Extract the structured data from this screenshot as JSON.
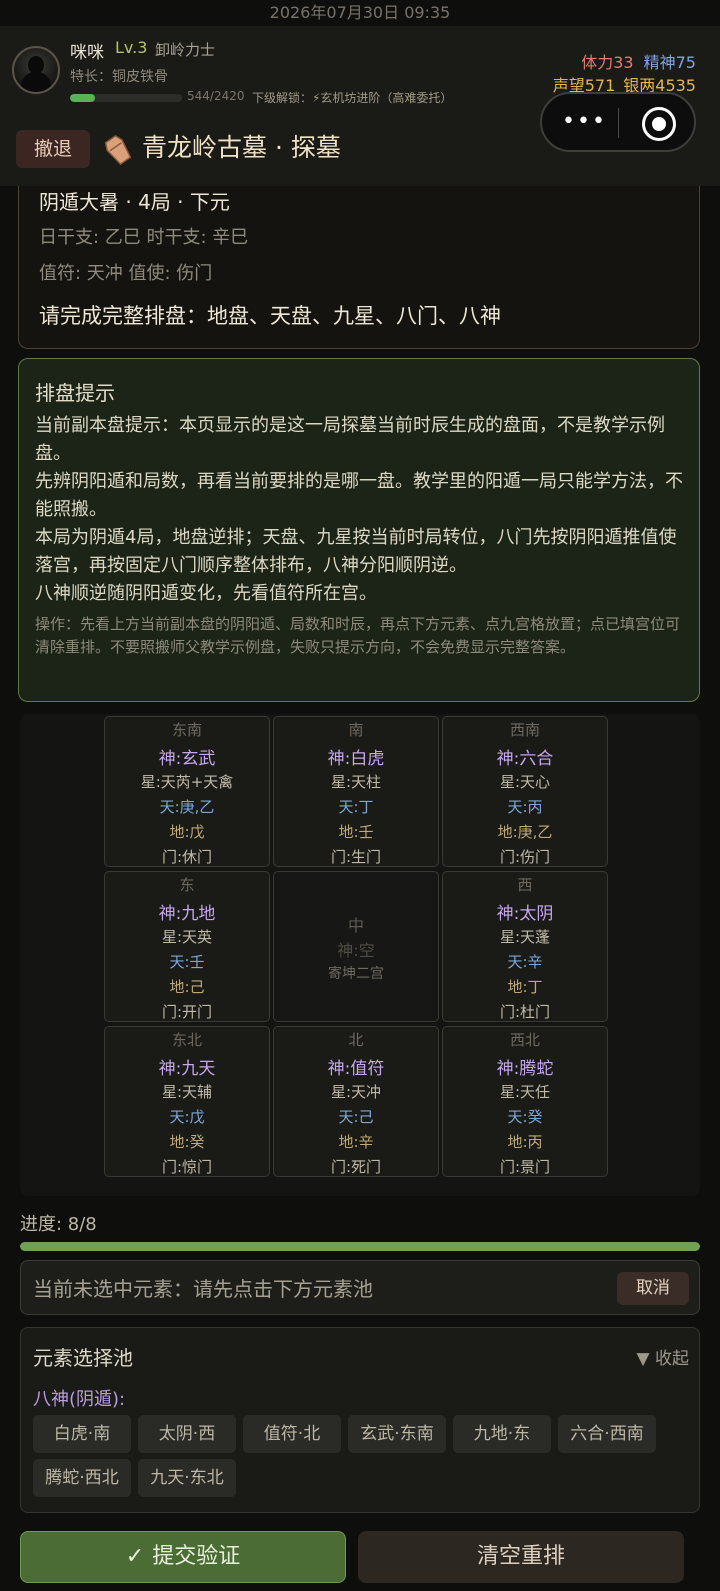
{
  "status_bar": {
    "datetime": "2026年07月30日 09:35"
  },
  "player": {
    "name": "咪咪",
    "level": "Lv.3",
    "title": "卸岭力士",
    "trait": "特长：铜皮铁骨",
    "xp_text": "544/2420",
    "xp_fraction": 0.225,
    "next_unlock": "下级解锁：⚡玄机坊进阶（高难委托）"
  },
  "stats": {
    "stamina": "体力33",
    "spirit": "精神75",
    "reputation": "声望571",
    "silver": "银两4535"
  },
  "nav": {
    "retreat_label": "撤退",
    "scene_title": "青龙岭古墓 · 探墓"
  },
  "chart_info": {
    "line1": "阴遁大暑 · 4局 · 下元",
    "line2": "日干支: 乙巳   时干支: 辛巳",
    "line3": "值符: 天冲   值使: 伤门",
    "task": "请完成完整排盘：地盘、天盘、九星、八门、八神"
  },
  "hint": {
    "title": "排盘提示",
    "paragraphs": [
      "当前副本盘提示：本页显示的是这一局探墓当前时辰生成的盘面，不是教学示例盘。",
      "先辨阴阳遁和局数，再看当前要排的是哪一盘。教学里的阳遁一局只能学方法，不能照搬。",
      "本局为阴遁4局，地盘逆排；天盘、九星按当前时局转位，八门先按阴阳遁推值使落宫，再按固定八门顺序整体排布，八神分阳顺阴逆。",
      "八神顺逆随阴阳遁变化，先看值符所在宫。"
    ],
    "operation": "操作：先看上方当前副本盘的阴阳遁、局数和时辰，再点下方元素、点九宫格放置；点已填宫位可清除重排。不要照搬师父教学示例盘，失败只提示方向，不会免费显示完整答案。"
  },
  "palaces": [
    {
      "dir": "东南",
      "shen": "神:玄武",
      "xing": "星:天芮+天禽",
      "tian": "天:庚,乙",
      "di": "地:戊",
      "men": "门:休门"
    },
    {
      "dir": "南",
      "shen": "神:白虎",
      "xing": "星:天柱",
      "tian": "天:丁",
      "di": "地:壬",
      "men": "门:生门"
    },
    {
      "dir": "西南",
      "shen": "神:六合",
      "xing": "星:天心",
      "tian": "天:丙",
      "di": "地:庚,乙",
      "men": "门:伤门"
    },
    {
      "dir": "东",
      "shen": "神:九地",
      "xing": "星:天英",
      "tian": "天:壬",
      "di": "地:己",
      "men": "门:开门"
    },
    {
      "dir": "中",
      "shen": "神:空",
      "note": "寄坤二宫"
    },
    {
      "dir": "西",
      "shen": "神:太阴",
      "xing": "星:天蓬",
      "tian": "天:辛",
      "di": "地:丁",
      "men": "门:杜门"
    },
    {
      "dir": "东北",
      "shen": "神:九天",
      "xing": "星:天辅",
      "tian": "天:戊",
      "di": "地:癸",
      "men": "门:惊门"
    },
    {
      "dir": "北",
      "shen": "神:值符",
      "xing": "星:天冲",
      "tian": "天:己",
      "di": "地:辛",
      "men": "门:死门"
    },
    {
      "dir": "西北",
      "shen": "神:腾蛇",
      "xing": "星:天任",
      "tian": "天:癸",
      "di": "地:丙",
      "men": "门:景门"
    }
  ],
  "progress": {
    "label": "进度: 8/8",
    "fraction": 1.0
  },
  "selection": {
    "text": "当前未选中元素：请先点击下方元素池",
    "cancel_label": "取消"
  },
  "pool": {
    "title": "元素选择池",
    "collapse_label": "▼ 收起",
    "group_label": "八神(阴遁):",
    "chips": [
      "白虎·南",
      "太阴·西",
      "值符·北",
      "玄武·东南",
      "九地·东",
      "六合·西南",
      "腾蛇·西北",
      "九天·东北"
    ]
  },
  "actions": {
    "submit_label": "提交验证",
    "clear_label": "清空重排"
  },
  "colors": {
    "accent_green": "#6fa150",
    "shen_purple": "#c6a6ef",
    "tian_blue": "#7da7d8",
    "di_gold": "#bfa975"
  }
}
